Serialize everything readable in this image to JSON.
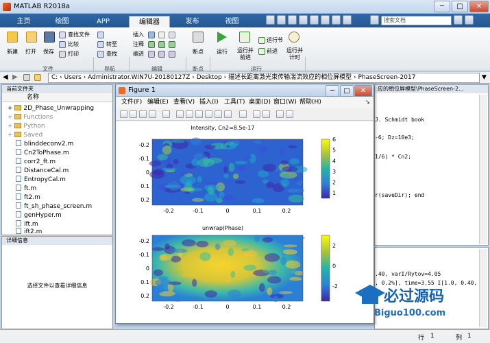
{
  "window": {
    "title": "MATLAB R2018a",
    "minimize": "─",
    "maximize": "□",
    "close": "✕"
  },
  "tabs": [
    "主页",
    "绘图",
    "APP",
    "编辑器",
    "发布",
    "视图"
  ],
  "active_tab": "编辑器",
  "search_placeholder": "搜索文档",
  "ribbon": {
    "file": {
      "new": "新建",
      "open": "打开",
      "save": "保存",
      "find_files": "查找文件",
      "compare": "比较",
      "print": "打印",
      "section": "文件"
    },
    "nav": {
      "goto": "转至",
      "find": "查找",
      "section": "导航"
    },
    "edit": {
      "insert": "插入",
      "comment": "注释",
      "indent": "缩进",
      "section": "编辑"
    },
    "breakpoints": {
      "label": "断点",
      "section": "断点"
    },
    "run": {
      "run": "运行",
      "run_advance": "运行并\n前进",
      "run_section": "运行节",
      "advance": "前进",
      "run_time": "运行并\n计时",
      "section": "运行"
    }
  },
  "address": {
    "path": "C: › Users › Administrator.WIN7U-20180127Z › Desktop › 描述长距离激光束传输湍流效应的相位屏模型 › PhaseScreen-2017"
  },
  "left_panel": {
    "title": "当前文件夹",
    "name_header": "名称",
    "items": [
      {
        "name": "2D_Phase_Unwrapping",
        "type": "folder",
        "dim": false
      },
      {
        "name": "Functions",
        "type": "folder",
        "dim": true
      },
      {
        "name": "Python",
        "type": "folder",
        "dim": true
      },
      {
        "name": "Saved",
        "type": "folder",
        "dim": true
      },
      {
        "name": "blinddeconv2.m",
        "type": "file"
      },
      {
        "name": "Cn2ToPhase.m",
        "type": "file"
      },
      {
        "name": "corr2_ft.m",
        "type": "file"
      },
      {
        "name": "DistanceCal.m",
        "type": "file"
      },
      {
        "name": "EntropyCal.m",
        "type": "file"
      },
      {
        "name": "ft.m",
        "type": "file"
      },
      {
        "name": "ft2.m",
        "type": "file"
      },
      {
        "name": "ft_sh_phase_screen.m",
        "type": "file"
      },
      {
        "name": "genHyper.m",
        "type": "file"
      },
      {
        "name": "ift.m",
        "type": "file"
      },
      {
        "name": "ift2.m",
        "type": "file"
      }
    ]
  },
  "details": {
    "title": "详细信息",
    "text": "选择文件以查看详细信息"
  },
  "editor": {
    "header": "应的相位屏模型\\PhaseScreen-2...",
    "lines": [
      "J. Schmidt book",
      "",
      "-6; Dz=10e3;",
      "",
      "1/6) * Cn2;",
      "",
      "",
      "r(saveDir);   end"
    ]
  },
  "command": {
    "lines": [
      ".40, varI/Rytov=4.05",
      ", 0.2%], time=3.55  I[1.0, 0.40,"
    ]
  },
  "statusbar": {
    "row": "行",
    "row_val": "1",
    "col": "列",
    "col_val": "1"
  },
  "figure": {
    "title": "Figure 1",
    "menus": [
      "文件(F)",
      "编辑(E)",
      "查看(V)",
      "插入(I)",
      "工具(T)",
      "桌面(D)",
      "窗口(W)",
      "帮助(H)"
    ]
  },
  "chart_data": [
    {
      "type": "heatmap",
      "title": "Intensity, Cn2=8.5e-17",
      "x_ticks": [
        "-0.2",
        "-0.1",
        "0",
        "0.1",
        "0.2"
      ],
      "y_ticks": [
        "-0.2",
        "-0.1",
        "0",
        "0.1",
        "0.2"
      ],
      "colorbar_ticks": [
        "1",
        "2",
        "3",
        "4",
        "5",
        "6"
      ],
      "colorbar_range": [
        0.5,
        6
      ],
      "colormap": "parula"
    },
    {
      "type": "heatmap",
      "title": "unwrap(Phase)",
      "x_ticks": [
        "-0.2",
        "-0.1",
        "0",
        "0.1",
        "0.2"
      ],
      "y_ticks": [
        "-0.2",
        "-0.1",
        "0",
        "0.1",
        "0.2"
      ],
      "colorbar_ticks": [
        "2",
        "0",
        "-2"
      ],
      "colorbar_range": [
        -3.5,
        3
      ],
      "colormap": "parula"
    }
  ],
  "watermark": {
    "brand": "必过源码",
    "url": "Biguo100.com"
  },
  "colors": {
    "tabbar": "#2a5f9a",
    "ribbon": "#eef1f4",
    "plot_low": "#3a34d4",
    "plot_high": "#f9e42a"
  }
}
